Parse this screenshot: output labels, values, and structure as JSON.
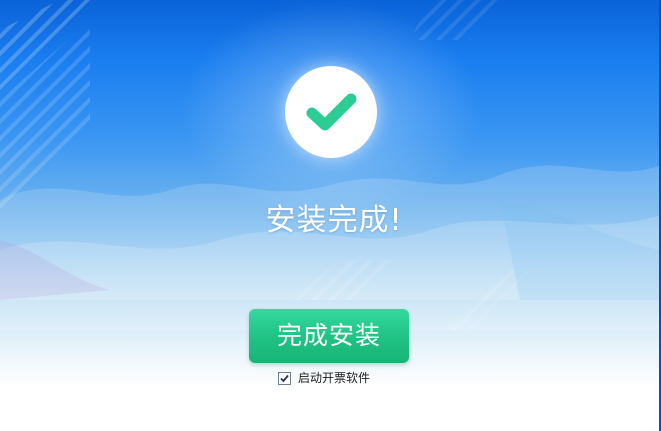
{
  "status": {
    "title": "安装完成!"
  },
  "actions": {
    "finish_label": "完成安装",
    "launch_label": "启动开票软件",
    "launch_checked": true
  },
  "colors": {
    "accent_green": "#1fc283",
    "check_green": "#2ccd95",
    "background_blue": "#1a7ef0"
  },
  "icons": {
    "success": "checkmark-icon",
    "checkbox": "checkbox-icon"
  }
}
